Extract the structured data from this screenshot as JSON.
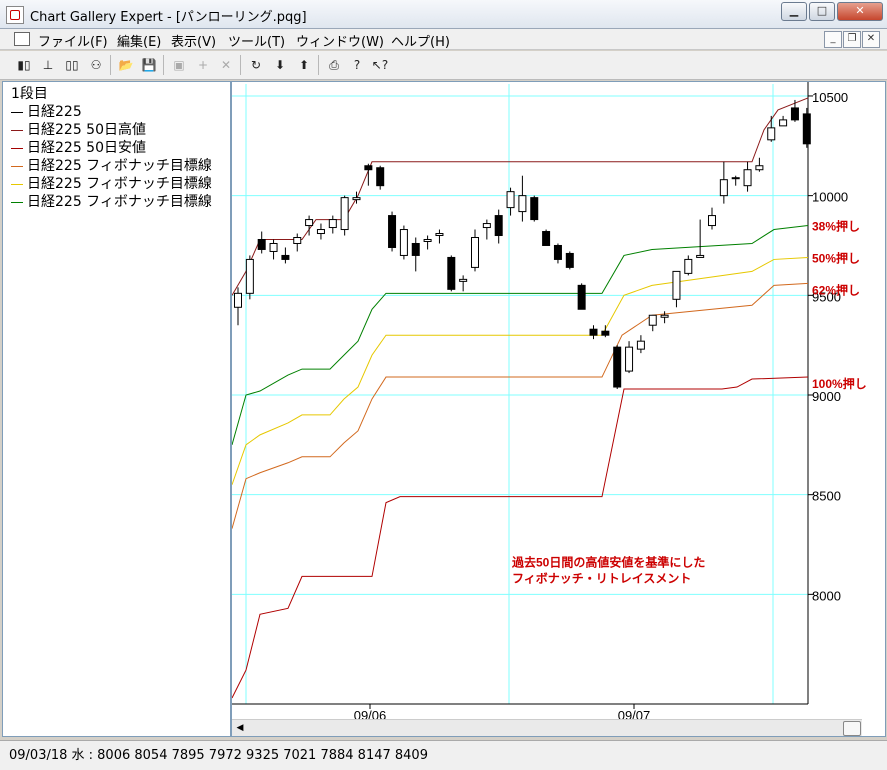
{
  "window": {
    "title": "Chart Gallery Expert - [パンローリング.pqg]"
  },
  "menu": {
    "items": [
      "ファイル(F)",
      "編集(E)",
      "表示(V)",
      "ツール(T)",
      "ウィンドウ(W)",
      "ヘルプ(H)"
    ]
  },
  "legend": {
    "heading": "1段目",
    "items": [
      {
        "label": "日経225",
        "color": "#000000"
      },
      {
        "label": "日経225 50日高値",
        "color": "#8b1a1a"
      },
      {
        "label": "日経225 50日安値",
        "color": "#a40000"
      },
      {
        "label": "日経225 フィボナッチ目標線",
        "color": "#d2691e"
      },
      {
        "label": "日経225 フィボナッチ目標線",
        "color": "#e6c800"
      },
      {
        "label": "日経225 フィボナッチ目標線",
        "color": "#008000"
      }
    ]
  },
  "annotations": {
    "p38": "38%押し",
    "p50": "50%押し",
    "p62": "62%押し",
    "p100": "100%押し",
    "note1": "過去50日間の高値安値を基準にした",
    "note2": "フィボナッチ・リトレイスメント"
  },
  "status": {
    "text": "09/03/18 水 : 8006 8054 7895 7972 9325 7021 7884 8147 8409"
  },
  "colors": {
    "grid": "#80ffff",
    "high": "#8b1a1a",
    "low": "#b00000",
    "fib62": "#d2691e",
    "fib50": "#e6c800",
    "fib38": "#008000",
    "annotation": "#cc0000"
  },
  "chart_data": {
    "type": "candlestick",
    "y_ticks": [
      8000,
      8500,
      9000,
      9500,
      10000,
      10500
    ],
    "ylim": [
      7450,
      10560
    ],
    "x_ticks": [
      "09/06",
      "09/07"
    ],
    "candles": [
      [
        9440,
        9540,
        9350,
        9510
      ],
      [
        9510,
        9700,
        9480,
        9680
      ],
      [
        9780,
        9820,
        9710,
        9730
      ],
      [
        9720,
        9780,
        9680,
        9760
      ],
      [
        9700,
        9740,
        9660,
        9680
      ],
      [
        9760,
        9810,
        9720,
        9790
      ],
      [
        9850,
        9900,
        9800,
        9880
      ],
      [
        9810,
        9860,
        9780,
        9830
      ],
      [
        9840,
        9900,
        9810,
        9880
      ],
      [
        9830,
        10000,
        9800,
        9990
      ],
      [
        9980,
        10020,
        9960,
        9990
      ],
      [
        10150,
        10160,
        10050,
        10130
      ],
      [
        10140,
        10150,
        10030,
        10050
      ],
      [
        9900,
        9920,
        9720,
        9740
      ],
      [
        9700,
        9850,
        9680,
        9830
      ],
      [
        9760,
        9790,
        9620,
        9700
      ],
      [
        9770,
        9800,
        9730,
        9780
      ],
      [
        9800,
        9830,
        9760,
        9810
      ],
      [
        9690,
        9700,
        9520,
        9530
      ],
      [
        9570,
        9600,
        9520,
        9580
      ],
      [
        9640,
        9830,
        9620,
        9790
      ],
      [
        9840,
        9880,
        9780,
        9860
      ],
      [
        9900,
        9930,
        9760,
        9800
      ],
      [
        9940,
        10040,
        9900,
        10020
      ],
      [
        9920,
        10100,
        9870,
        10000
      ],
      [
        9990,
        10000,
        9870,
        9880
      ],
      [
        9820,
        9830,
        9750,
        9750
      ],
      [
        9750,
        9760,
        9660,
        9680
      ],
      [
        9710,
        9720,
        9630,
        9640
      ],
      [
        9550,
        9560,
        9430,
        9430
      ],
      [
        9330,
        9350,
        9280,
        9300
      ],
      [
        9320,
        9350,
        9290,
        9300
      ],
      [
        9240,
        9250,
        9030,
        9040
      ],
      [
        9120,
        9270,
        9110,
        9240
      ],
      [
        9230,
        9300,
        9210,
        9270
      ],
      [
        9350,
        9400,
        9320,
        9400
      ],
      [
        9390,
        9420,
        9360,
        9400
      ],
      [
        9480,
        9620,
        9440,
        9620
      ],
      [
        9610,
        9700,
        9600,
        9680
      ],
      [
        9690,
        9880,
        9690,
        9700
      ],
      [
        9850,
        9940,
        9830,
        9900
      ],
      [
        10000,
        10170,
        9960,
        10080
      ],
      [
        10090,
        10100,
        10050,
        10090
      ],
      [
        10050,
        10170,
        10020,
        10130
      ],
      [
        10130,
        10190,
        10120,
        10150
      ],
      [
        10280,
        10400,
        10270,
        10340
      ],
      [
        10350,
        10400,
        10360,
        10380
      ],
      [
        10440,
        10480,
        10370,
        10380
      ],
      [
        10410,
        10440,
        10240,
        10260
      ]
    ]
  }
}
